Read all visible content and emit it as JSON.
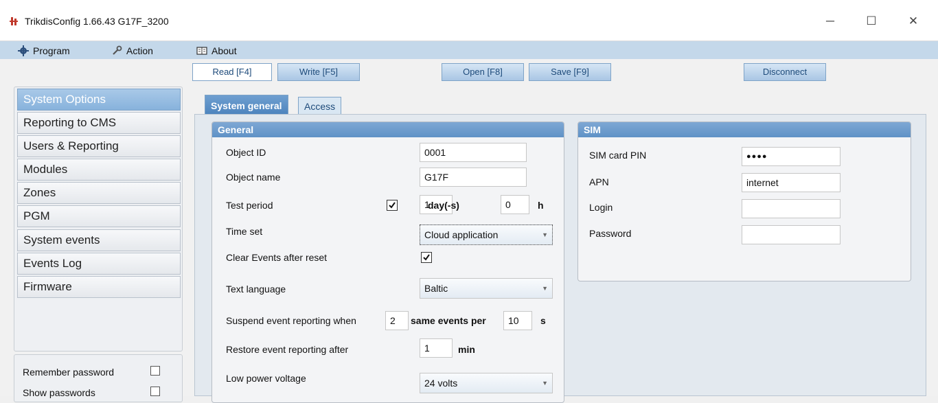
{
  "window": {
    "title": "TrikdisConfig 1.66.43   G17F_3200",
    "minimize": "─",
    "maximize": "☐",
    "close": "✕"
  },
  "menu": {
    "program": "Program",
    "action": "Action",
    "about": "About"
  },
  "toolbar": {
    "read": "Read [F4]",
    "write": "Write [F5]",
    "open": "Open [F8]",
    "save": "Save [F9]",
    "disconnect": "Disconnect"
  },
  "nav": {
    "items": [
      "System Options",
      "Reporting to CMS",
      "Users & Reporting",
      "Modules",
      "Zones",
      "PGM",
      "System events",
      "Events Log",
      "Firmware"
    ]
  },
  "options": {
    "remember_password": "Remember password",
    "show_passwords": "Show passwords"
  },
  "tabs": {
    "system_general": "System general",
    "access": "Access"
  },
  "general": {
    "header": "General",
    "object_id_label": "Object ID",
    "object_id_value": "0001",
    "object_name_label": "Object name",
    "object_name_value": "G17F",
    "test_period_label": "Test period",
    "test_period_days": "1",
    "days_unit": "day(-s)",
    "test_period_hours": "0",
    "hours_unit": "h",
    "time_set_label": "Time set",
    "time_set_value": "Cloud application",
    "clear_events_label": "Clear Events after reset",
    "text_language_label": "Text language",
    "text_language_value": "Baltic",
    "suspend_label": "Suspend event reporting when",
    "suspend_count": "2",
    "same_events_per": "same events per",
    "suspend_seconds": "10",
    "seconds_unit": "s",
    "restore_label": "Restore event reporting after",
    "restore_value": "1",
    "min_unit": "min",
    "low_power_label": "Low power voltage",
    "low_power_value": "24 volts"
  },
  "sim": {
    "header": "SIM",
    "pin_label": "SIM card PIN",
    "pin_value": "●●●●",
    "apn_label": "APN",
    "apn_value": "internet",
    "login_label": "Login",
    "login_value": "",
    "password_label": "Password",
    "password_value": ""
  }
}
